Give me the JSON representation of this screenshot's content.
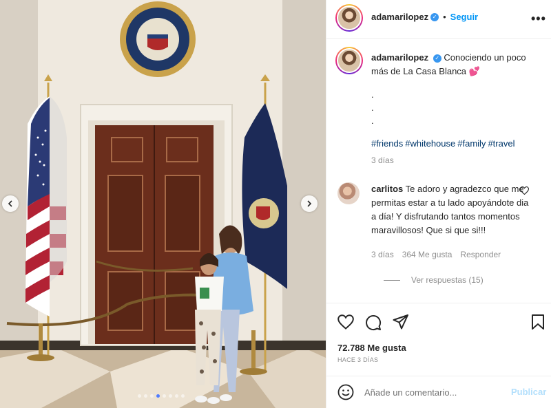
{
  "post": {
    "username": "adamarilopez",
    "follow_label": "Seguir",
    "separator": "•",
    "more_label": "•••",
    "caption": "Conociendo un poco más de La Casa Blanca",
    "caption_emoji": "💕",
    "caption_dots": [
      ".",
      ".",
      "."
    ],
    "hashtags": [
      "#friends",
      "#whitehouse",
      "#family",
      "#travel"
    ],
    "caption_time": "3 días",
    "likes": "72.788 Me gusta",
    "date": "HACE 3 DÍAS"
  },
  "comment": {
    "username": "carlitos",
    "text": "Te adoro y agradezco que me permitas estar a tu lado apoyándote dia a día! Y disfrutando tantos momentos maravillosos! Que si que si!!!",
    "time": "3 días",
    "likes": "364 Me gusta",
    "reply_label": "Responder",
    "view_replies": "Ver respuestas (15)"
  },
  "composer": {
    "placeholder": "Añade un comentario...",
    "publish_label": "Publicar"
  },
  "icons": {
    "verified": "verified-badge-icon",
    "like": "heart-icon",
    "comment": "comment-icon",
    "share": "send-icon",
    "save": "bookmark-icon",
    "emoji": "emoji-icon",
    "prev": "chevron-left-icon",
    "next": "chevron-right-icon"
  },
  "carousel": {
    "total": 8,
    "active_index": 3
  },
  "colors": {
    "link": "#00376b",
    "follow": "#0095f6",
    "verified": "#3897f0",
    "secondary_text": "#8e8e8e",
    "publish_disabled": "#b2dffc"
  }
}
